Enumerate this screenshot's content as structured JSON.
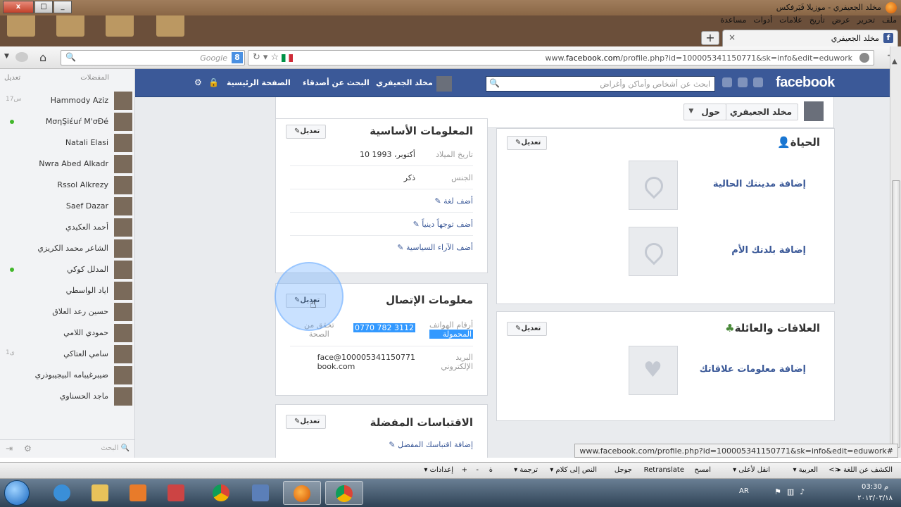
{
  "window": {
    "title": "مخلد الجعيفري - موزيلا فَيَرفكس",
    "menus": [
      "ملف",
      "تحرير",
      "عرض",
      "تأريخ",
      "علامات",
      "أدوات",
      "مساعدة"
    ],
    "tab_title": "مخلد الجعيفري",
    "newtab_label": "+",
    "close_label": "x",
    "maximize_label": "□",
    "minimize_label": "_"
  },
  "navbar": {
    "url_prefix": "www.",
    "url_domain": "facebook.com",
    "url_rest": "/profile.php?id=100005341150771&sk=info&edit=eduwork",
    "search_placeholder": "Google",
    "google_badge": "8"
  },
  "chat": {
    "header_right": "المفضلات",
    "header_left": "تعديل",
    "items": [
      {
        "name": "Hammody Aziz",
        "status": "17س",
        "online": false
      },
      {
        "name": "MσηŞiέuŕ M'σĐé",
        "status": "",
        "online": true
      },
      {
        "name": "Natali Elasi",
        "status": "",
        "online": false
      },
      {
        "name": "Nwra Abed Alkadr",
        "status": "",
        "online": false
      },
      {
        "name": "Rssol Alkrezy",
        "status": "",
        "online": false
      },
      {
        "name": "Saef Dazar",
        "status": "",
        "online": false
      },
      {
        "name": "أحمد العكيدي",
        "status": "",
        "online": false
      },
      {
        "name": "الشاعر محمد الكريزي",
        "status": "",
        "online": false
      },
      {
        "name": "المدلل كوكي",
        "status": "",
        "online": true
      },
      {
        "name": "اياد الواسطي",
        "status": "",
        "online": false
      },
      {
        "name": "حسين رعد العلاق",
        "status": "",
        "online": false
      },
      {
        "name": "حمودي اللامي",
        "status": "",
        "online": false
      },
      {
        "name": "سامي العتاكي",
        "status": "1ى",
        "online": false
      },
      {
        "name": "ضيبرغيبامه البيجيبوذري",
        "status": "",
        "online": false
      },
      {
        "name": "ماجد الحسناوي",
        "status": "",
        "online": false
      }
    ],
    "search_label": "البحث"
  },
  "fb": {
    "logo": "facebook",
    "search_placeholder": "ابحث عن أشخاص وأماكن وأغراض",
    "profile_name": "مخلد الجعيفري",
    "find_friends": "البحث عن أصدقاء",
    "home": "الصفحة الرئيسية"
  },
  "profile_bar": {
    "name": "مخلد الجعيفري",
    "about": "حول"
  },
  "basic_info": {
    "title": "المعلومات الأساسية",
    "edit": "تعديل",
    "rows": [
      {
        "label": "تاريخ الميلاد",
        "value": "10 أكتوبر، 1993"
      },
      {
        "label": "الجنس",
        "value": "ذكر"
      }
    ],
    "links": [
      "أضف لغة",
      "أضف توجهاً دينياً",
      "أضف الآراء السياسية"
    ]
  },
  "contact_info": {
    "title": "معلومات الإتصال",
    "edit": "تعديل",
    "phone_label": "أرقام الهواتف",
    "phone_label2": "المحمولة",
    "phone_value": "0770 782 3112",
    "verify": "تحقق من",
    "verify2": "الصحة",
    "email_label": "البريد",
    "email_label2": "الإلكتروني",
    "email_value": "face@100005341150771",
    "email_value2": "book.com"
  },
  "quotes": {
    "title": "الاقتباسات المفضلة",
    "edit": "تعديل",
    "link": "إضافة اقتباسك المفضل"
  },
  "life": {
    "title": "الحياة",
    "edit": "تعديل",
    "current_city": "إضافة مدينتك الحالية",
    "hometown": "إضافة بلدتك الأم"
  },
  "relationships": {
    "title": "العلاقات والعائلة",
    "edit": "تعديل",
    "link": "إضافة معلومات علاقاتك"
  },
  "status_url": "www.facebook.com/profile.php?id=100005341150771&sk=info&edit=eduwork#",
  "translate_bar": {
    "items": [
      "الكشف عن اللغة",
      "<>",
      "العربية",
      "انقل لأعلى",
      "امسح",
      "Retranslate",
      "جوجل",
      "النص إلى كلام",
      "ترجمة",
      "ة",
      "-",
      "+",
      "إعدادات"
    ]
  },
  "taskbar": {
    "lang": "AR",
    "time": "03:30 م",
    "date": "٢٠١٣/٠٣/١٨"
  }
}
